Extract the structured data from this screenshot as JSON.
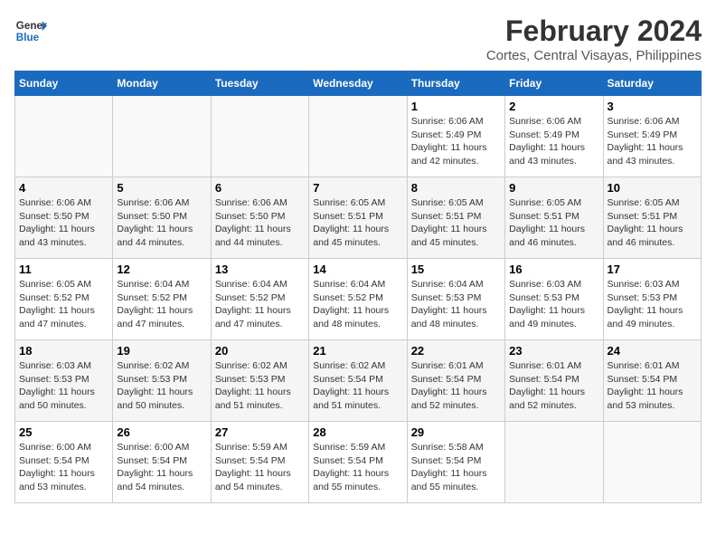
{
  "logo": {
    "line1": "General",
    "line2": "Blue"
  },
  "title": "February 2024",
  "subtitle": "Cortes, Central Visayas, Philippines",
  "columns": [
    "Sunday",
    "Monday",
    "Tuesday",
    "Wednesday",
    "Thursday",
    "Friday",
    "Saturday"
  ],
  "weeks": [
    [
      {
        "day": "",
        "info": ""
      },
      {
        "day": "",
        "info": ""
      },
      {
        "day": "",
        "info": ""
      },
      {
        "day": "",
        "info": ""
      },
      {
        "day": "1",
        "sunrise": "6:06 AM",
        "sunset": "5:49 PM",
        "daylight": "11 hours and 42 minutes."
      },
      {
        "day": "2",
        "sunrise": "6:06 AM",
        "sunset": "5:49 PM",
        "daylight": "11 hours and 43 minutes."
      },
      {
        "day": "3",
        "sunrise": "6:06 AM",
        "sunset": "5:49 PM",
        "daylight": "11 hours and 43 minutes."
      }
    ],
    [
      {
        "day": "4",
        "sunrise": "6:06 AM",
        "sunset": "5:50 PM",
        "daylight": "11 hours and 43 minutes."
      },
      {
        "day": "5",
        "sunrise": "6:06 AM",
        "sunset": "5:50 PM",
        "daylight": "11 hours and 44 minutes."
      },
      {
        "day": "6",
        "sunrise": "6:06 AM",
        "sunset": "5:50 PM",
        "daylight": "11 hours and 44 minutes."
      },
      {
        "day": "7",
        "sunrise": "6:05 AM",
        "sunset": "5:51 PM",
        "daylight": "11 hours and 45 minutes."
      },
      {
        "day": "8",
        "sunrise": "6:05 AM",
        "sunset": "5:51 PM",
        "daylight": "11 hours and 45 minutes."
      },
      {
        "day": "9",
        "sunrise": "6:05 AM",
        "sunset": "5:51 PM",
        "daylight": "11 hours and 46 minutes."
      },
      {
        "day": "10",
        "sunrise": "6:05 AM",
        "sunset": "5:51 PM",
        "daylight": "11 hours and 46 minutes."
      }
    ],
    [
      {
        "day": "11",
        "sunrise": "6:05 AM",
        "sunset": "5:52 PM",
        "daylight": "11 hours and 47 minutes."
      },
      {
        "day": "12",
        "sunrise": "6:04 AM",
        "sunset": "5:52 PM",
        "daylight": "11 hours and 47 minutes."
      },
      {
        "day": "13",
        "sunrise": "6:04 AM",
        "sunset": "5:52 PM",
        "daylight": "11 hours and 47 minutes."
      },
      {
        "day": "14",
        "sunrise": "6:04 AM",
        "sunset": "5:52 PM",
        "daylight": "11 hours and 48 minutes."
      },
      {
        "day": "15",
        "sunrise": "6:04 AM",
        "sunset": "5:53 PM",
        "daylight": "11 hours and 48 minutes."
      },
      {
        "day": "16",
        "sunrise": "6:03 AM",
        "sunset": "5:53 PM",
        "daylight": "11 hours and 49 minutes."
      },
      {
        "day": "17",
        "sunrise": "6:03 AM",
        "sunset": "5:53 PM",
        "daylight": "11 hours and 49 minutes."
      }
    ],
    [
      {
        "day": "18",
        "sunrise": "6:03 AM",
        "sunset": "5:53 PM",
        "daylight": "11 hours and 50 minutes."
      },
      {
        "day": "19",
        "sunrise": "6:02 AM",
        "sunset": "5:53 PM",
        "daylight": "11 hours and 50 minutes."
      },
      {
        "day": "20",
        "sunrise": "6:02 AM",
        "sunset": "5:53 PM",
        "daylight": "11 hours and 51 minutes."
      },
      {
        "day": "21",
        "sunrise": "6:02 AM",
        "sunset": "5:54 PM",
        "daylight": "11 hours and 51 minutes."
      },
      {
        "day": "22",
        "sunrise": "6:01 AM",
        "sunset": "5:54 PM",
        "daylight": "11 hours and 52 minutes."
      },
      {
        "day": "23",
        "sunrise": "6:01 AM",
        "sunset": "5:54 PM",
        "daylight": "11 hours and 52 minutes."
      },
      {
        "day": "24",
        "sunrise": "6:01 AM",
        "sunset": "5:54 PM",
        "daylight": "11 hours and 53 minutes."
      }
    ],
    [
      {
        "day": "25",
        "sunrise": "6:00 AM",
        "sunset": "5:54 PM",
        "daylight": "11 hours and 53 minutes."
      },
      {
        "day": "26",
        "sunrise": "6:00 AM",
        "sunset": "5:54 PM",
        "daylight": "11 hours and 54 minutes."
      },
      {
        "day": "27",
        "sunrise": "5:59 AM",
        "sunset": "5:54 PM",
        "daylight": "11 hours and 54 minutes."
      },
      {
        "day": "28",
        "sunrise": "5:59 AM",
        "sunset": "5:54 PM",
        "daylight": "11 hours and 55 minutes."
      },
      {
        "day": "29",
        "sunrise": "5:58 AM",
        "sunset": "5:54 PM",
        "daylight": "11 hours and 55 minutes."
      },
      {
        "day": "",
        "info": ""
      },
      {
        "day": "",
        "info": ""
      }
    ]
  ],
  "labels": {
    "sunrise_prefix": "Sunrise: ",
    "sunset_prefix": "Sunset: ",
    "daylight_prefix": "Daylight: "
  }
}
